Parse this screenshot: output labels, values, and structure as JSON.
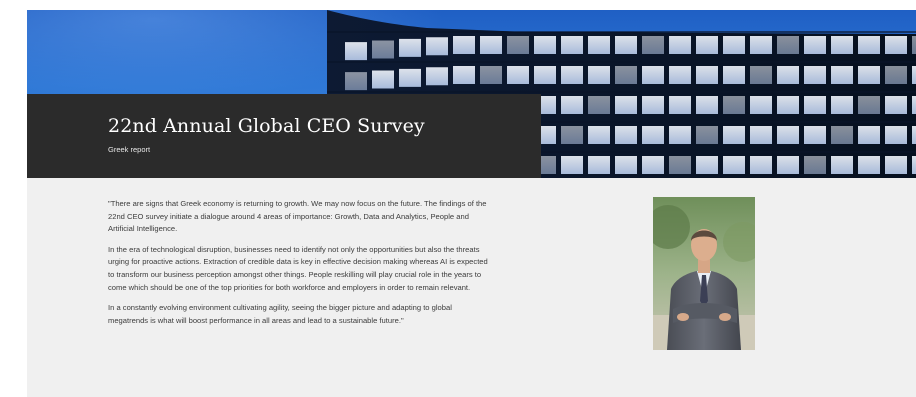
{
  "hero": {
    "title": "22nd Annual Global CEO Survey",
    "subtitle": "Greek report"
  },
  "quote": {
    "paragraphs": [
      "\"There are signs that Greek economy is returning to growth.  We may now focus on the future. The findings of the 22nd CEO survey initiate a dialogue around 4 areas of importance: Growth, Data and Analytics, People and Artificial Intelligence.",
      "In the era of technological disruption, businesses need to identify not only the opportunities but also the threats urging for proactive actions. Extraction of credible  data is key in effective decision making whereas AI is expected to transform our business perception amongst other things. People reskilling will play crucial role in the years to come which should be one of the top priorities for both workforce and employers in order to remain relevant.",
      "In a constantly evolving environment cultivating agility, seeing the bigger picture and adapting to global megatrends is what will boost performance in all areas and lead to a sustainable future.\""
    ]
  },
  "colors": {
    "sky": "#2f78d6",
    "title_band": "#2b2b2b",
    "content_bg": "#f0f0f0",
    "text": "#3c3c3c"
  }
}
